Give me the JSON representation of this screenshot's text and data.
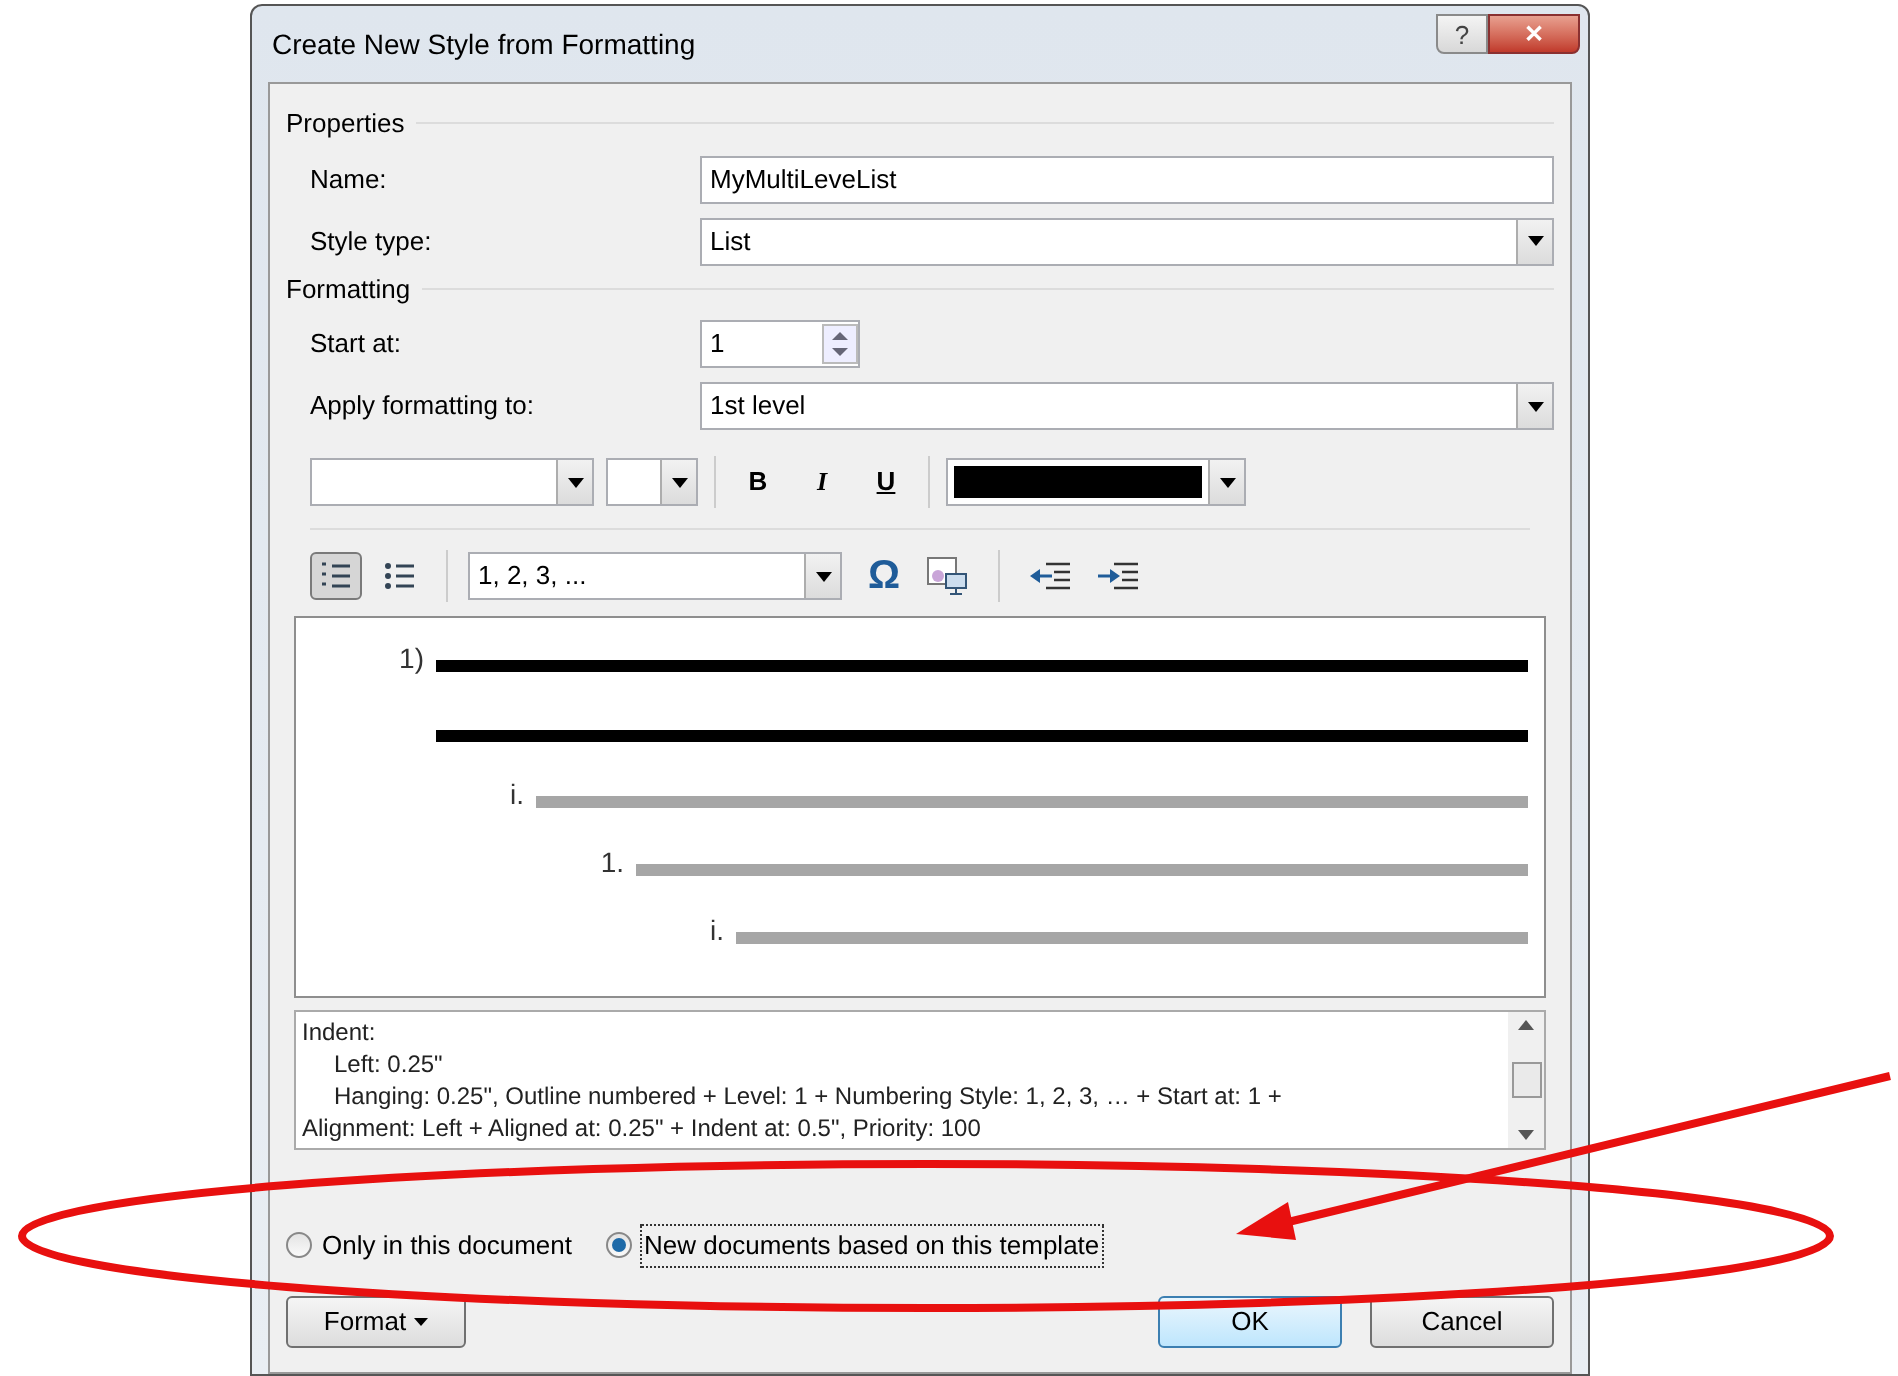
{
  "window": {
    "title": "Create New Style from Formatting",
    "help_button": "?",
    "close_button": "✕"
  },
  "properties": {
    "heading": "Properties",
    "name_label": "Name:",
    "name_value": "MyMultiLeveList",
    "style_type_label": "Style type:",
    "style_type_value": "List"
  },
  "formatting": {
    "heading": "Formatting",
    "start_at_label": "Start at:",
    "start_at_value": "1",
    "apply_label": "Apply formatting to:",
    "apply_value": "1st level",
    "font_toolbar": {
      "bold": "B",
      "italic": "I",
      "underline": "U"
    },
    "list_toolbar": {
      "numbered_selected": true,
      "bulleted_selected": false,
      "numbering_style": "1, 2, 3, ...",
      "symbol": "Ω"
    },
    "preview": [
      {
        "label": "1)",
        "active": true,
        "children": [
          {
            "label": "i.",
            "active": false,
            "children": [
              {
                "label": "1.",
                "active": false,
                "children": [
                  {
                    "label": "i.",
                    "active": false
                  }
                ]
              }
            ]
          }
        ]
      }
    ],
    "description": [
      {
        "text": "Indent:",
        "indented": false
      },
      {
        "text": "Left:  0.25\"",
        "indented": true
      },
      {
        "text": "Hanging:  0.25\", Outline numbered + Level: 1 + Numbering Style: 1, 2, 3, … + Start at: 1 +",
        "indented": true
      },
      {
        "text": "Alignment: Left + Aligned at:  0.25\" + Indent at:  0.5\", Priority: 100",
        "indented": false
      }
    ]
  },
  "scope": [
    {
      "label": "Only in this document",
      "selected": false
    },
    {
      "label": "New documents based on this template",
      "selected": true
    }
  ],
  "buttons": {
    "format": "Format",
    "ok": "OK",
    "cancel": "Cancel"
  }
}
